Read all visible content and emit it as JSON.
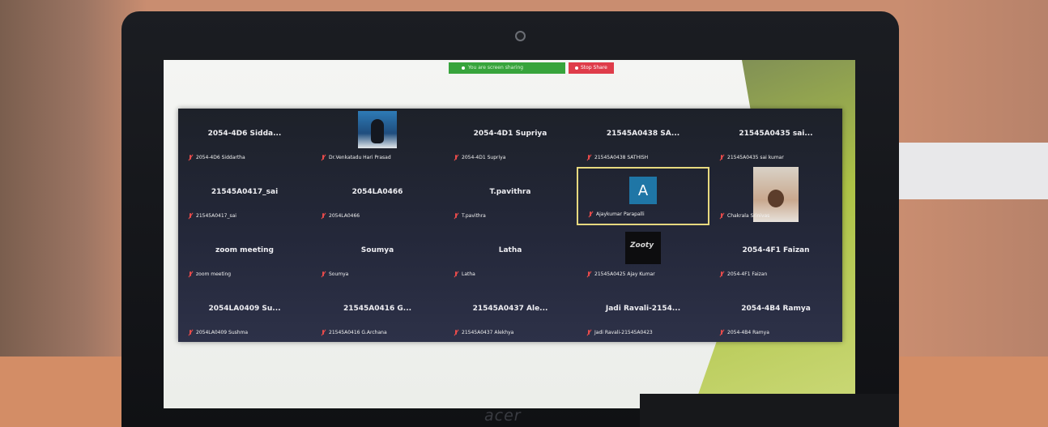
{
  "laptop": {
    "brand": "acer"
  },
  "share_toolbar": {
    "status_text": "You are screen sharing",
    "stop_button": "Stop Share"
  },
  "gallery": {
    "tiles": [
      {
        "name": "2054-4D6 Sidda...",
        "caption": "2054-4D6 Siddartha",
        "kind": "name"
      },
      {
        "name": "",
        "caption": "Dr.Venkatadu Hari Prasad",
        "kind": "photo-penguin"
      },
      {
        "name": "2054-4D1 Supriya",
        "caption": "2054-4D1 Supriya",
        "kind": "name"
      },
      {
        "name": "21545A0438 SA...",
        "caption": "21545A0438 SATHISH",
        "kind": "name"
      },
      {
        "name": "21545A0435 sai...",
        "caption": "21545A0435 sai kumar",
        "kind": "name"
      },
      {
        "name": "21545A0417_sai",
        "caption": "21545A0417_sai",
        "kind": "name"
      },
      {
        "name": "2054LA0466",
        "caption": "2054LA0466",
        "kind": "name"
      },
      {
        "name": "T.pavithra",
        "caption": "T.pavithra",
        "kind": "name"
      },
      {
        "name": "",
        "caption": "Ajaykumar Parapalli",
        "kind": "avatar",
        "initial": "A",
        "active": true
      },
      {
        "name": "",
        "caption": "Chakrala Srinivas",
        "kind": "photo-person"
      },
      {
        "name": "zoom meeting",
        "caption": "zoom meeting",
        "kind": "name"
      },
      {
        "name": "Soumya",
        "caption": "Soumya",
        "kind": "name"
      },
      {
        "name": "Latha",
        "caption": "Latha",
        "kind": "name"
      },
      {
        "name": "",
        "caption": "21545A0425 Ajay Kumar",
        "kind": "logo",
        "logo_text": "Zooty"
      },
      {
        "name": "2054-4F1 Faizan",
        "caption": "2054-4F1 Faizan",
        "kind": "name"
      },
      {
        "name": "2054LA0409 Su...",
        "caption": "2054LA0409 Sushma",
        "kind": "name"
      },
      {
        "name": "21545A0416 G...",
        "caption": "21545A0416 G.Archana",
        "kind": "name"
      },
      {
        "name": "21545A0437 Ale...",
        "caption": "21545A0437 Alekhya",
        "kind": "name"
      },
      {
        "name": "Jadi Ravali-2154...",
        "caption": "Jadi Ravali-21545A0423",
        "kind": "name"
      },
      {
        "name": "2054-4B4 Ramya",
        "caption": "2054-4B4 Ramya",
        "kind": "name"
      }
    ]
  },
  "colors": {
    "share_green": "#37a43c",
    "stop_red": "#df3c4a",
    "active_speaker": "#e7d97f",
    "avatar_blue": "#1f76a6",
    "muted_mic": "#e84b4b"
  }
}
